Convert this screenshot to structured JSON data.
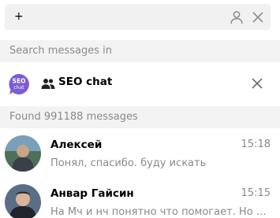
{
  "search": {
    "value": "+",
    "user_filter_icon": "person-outline-icon",
    "clear_icon": "close-icon"
  },
  "sections": {
    "search_in_label": "Search messages in",
    "found_label": "Found 991188 messages"
  },
  "chat_filter": {
    "logo_text_top": "SEO",
    "logo_text_bottom": "chat",
    "group_icon": "group-icon",
    "name": "SEO chat",
    "remove_icon": "close-icon",
    "logo_color": "#7b5cd6"
  },
  "results": [
    {
      "name": "Алексей",
      "time": "15:18",
      "text": "Понял, спасибо. буду искать"
    },
    {
      "name": "Анвар Гайсин",
      "time": "15:15",
      "text": "На Мч и нч понятно что помогает. Но как с вч"
    }
  ]
}
